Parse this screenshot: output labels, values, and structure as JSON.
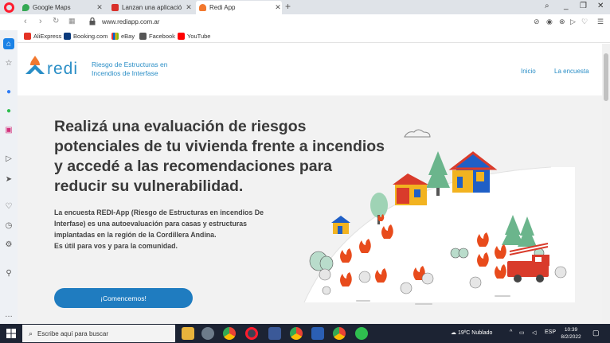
{
  "tabs": [
    {
      "label": "Google Maps",
      "fav_color": "#34a853",
      "active": false
    },
    {
      "label": "Lanzan una aplicación para",
      "fav_color": "#d9302a",
      "active": false
    },
    {
      "label": "Redi App",
      "fav_color": "#f2782e",
      "active": true
    }
  ],
  "address": {
    "url": "www.rediapp.com.ar"
  },
  "bookmarks": [
    {
      "label": "AliExpress",
      "color": "#e43225"
    },
    {
      "label": "Booking.com",
      "color": "#0c3b7c"
    },
    {
      "label": "eBay",
      "color": "#e53238"
    },
    {
      "label": "Facebook",
      "color": "#3b5998"
    },
    {
      "label": "YouTube",
      "color": "#ff0000"
    }
  ],
  "site": {
    "logo_word": "redi",
    "logo_subtitle": "Riesgo de Estructuras en Incendios de Interfase",
    "nav": [
      "Inicio",
      "La encuesta"
    ],
    "headline": "Realizá una evaluación de riesgos potenciales de tu vivienda frente a incendios y accedé a las recomendaciones para reducir su vulnerabilidad.",
    "description": [
      "La encuesta REDI-App (Riesgo de Estructuras en incendios De",
      "Interfase) es una autoevaluación para casas y estructuras",
      "implantadas en la región de la Cordillera Andina.",
      "Es útil para vos y para la comunidad."
    ],
    "cta_label": "¡Comencemos!",
    "accent_color": "#2a8ec6",
    "button_color": "#1f7cc0"
  },
  "taskbar": {
    "search_placeholder": "Escribe aquí para buscar",
    "weather": "19ºC  Nublado",
    "language": "ESP",
    "time": "10:39",
    "date": "8/2/2022"
  }
}
